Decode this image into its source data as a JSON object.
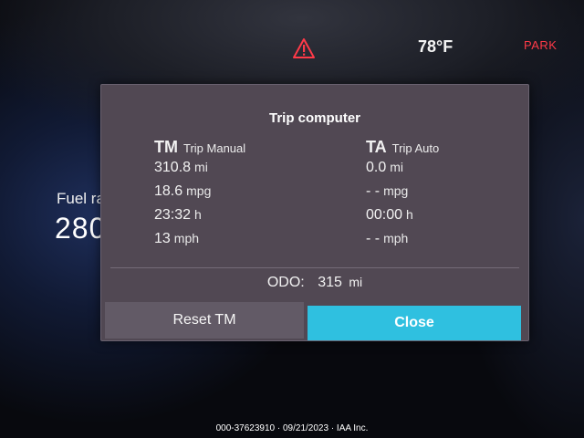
{
  "status_bar": {
    "warning_icon": "warning-triangle-icon",
    "temperature": "78°F",
    "gear": "PARK",
    "warning_color": "#ff3a48"
  },
  "background_gauge": {
    "fuel_label": "Fuel ra",
    "fuel_value": "280"
  },
  "trip_dialog": {
    "title": "Trip computer",
    "trip_manual": {
      "abbr": "TM",
      "name": "Trip Manual",
      "rows": [
        {
          "value": "310.8",
          "unit": "mi"
        },
        {
          "value": "18.6",
          "unit": "mpg"
        },
        {
          "value": "23:32",
          "unit": "h"
        },
        {
          "value": "13",
          "unit": "mph"
        }
      ]
    },
    "trip_auto": {
      "abbr": "TA",
      "name": "Trip Auto",
      "rows": [
        {
          "value": "0.0",
          "unit": "mi"
        },
        {
          "value": "- -",
          "unit": "mpg"
        },
        {
          "value": "00:00",
          "unit": "h"
        },
        {
          "value": "- -",
          "unit": "mph"
        }
      ]
    },
    "odometer": {
      "label": "ODO:",
      "value": "315",
      "unit": "mi"
    },
    "reset_button": "Reset TM",
    "close_button": "Close",
    "accent_color": "#2fc0e0"
  },
  "caption": "000-37623910 · 09/21/2023 · IAA Inc."
}
